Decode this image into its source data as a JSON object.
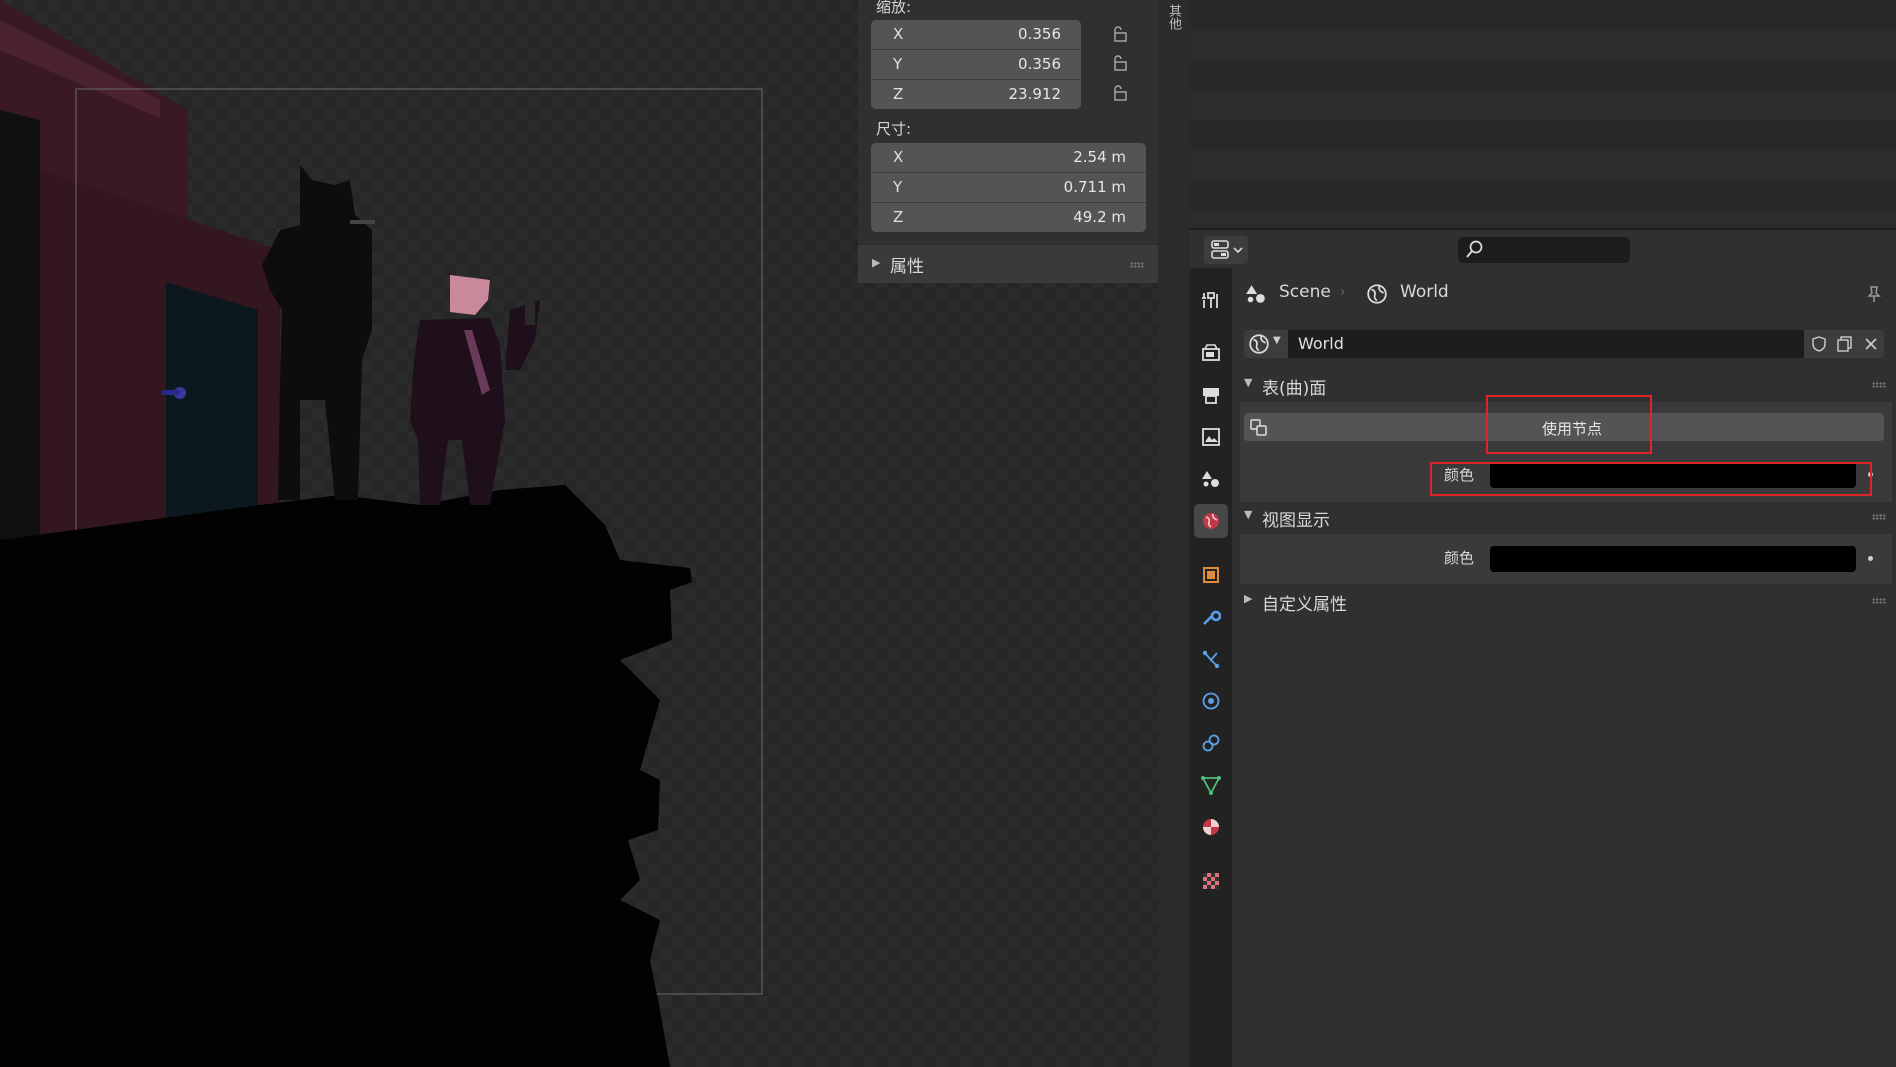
{
  "n_panel": {
    "scale": {
      "label": "缩放:",
      "rows": [
        {
          "axis": "X",
          "value": "0.356"
        },
        {
          "axis": "Y",
          "value": "0.356"
        },
        {
          "axis": "Z",
          "value": "23.912"
        }
      ]
    },
    "dimensions": {
      "label": "尺寸:",
      "rows": [
        {
          "axis": "X",
          "value": "2.54 m"
        },
        {
          "axis": "Y",
          "value": "0.711 m"
        },
        {
          "axis": "Z",
          "value": "49.2 m"
        }
      ]
    },
    "properties_panel": "属性",
    "side_tab": "其他"
  },
  "properties": {
    "breadcrumb": {
      "scene": "Scene",
      "world": "World"
    },
    "world_datablock": "World",
    "surface_panel": {
      "title": "表(曲)面",
      "use_nodes": "使用节点",
      "color_label": "颜色",
      "color_value": "#000000"
    },
    "viewport_display_panel": {
      "title": "视图显示",
      "color_label": "颜色",
      "color_value": "#000000"
    },
    "custom_properties_panel": {
      "title": "自定义属性"
    }
  },
  "colors": {
    "highlight": "#e0242a",
    "accent_active_tab": "#474747"
  }
}
